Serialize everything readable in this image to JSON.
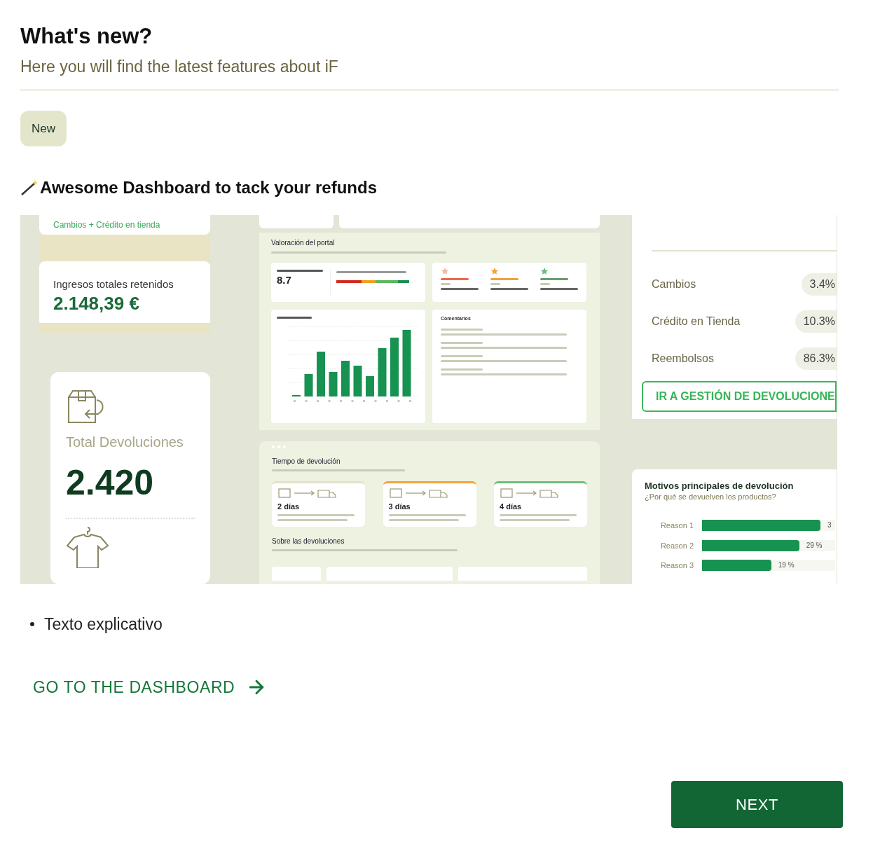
{
  "header": {
    "title": "What's new?",
    "subtitle": "Here you will find the latest features about iF"
  },
  "badge": "New",
  "feature_title": "Awesome Dashboard to tack your refunds",
  "preview": {
    "left": {
      "caption": "Cambios + Crédito en tienda",
      "revenue_label": "Ingresos totales retenidos",
      "revenue_value": "2.148,39 €",
      "returns_label": "Total Devoluciones",
      "returns_value": "2.420"
    },
    "portal": {
      "title": "Valoración del portal",
      "score": "8.7",
      "comments_title": "Comentarios",
      "star_groups": [
        {
          "color": "#f2b9a2"
        },
        {
          "color": "#f4a338"
        },
        {
          "color": "#6dbb7e"
        }
      ]
    },
    "times": {
      "title": "Tiempo de devolución",
      "cards": [
        {
          "value": "2 días",
          "color": "#e6e2c8"
        },
        {
          "value": "3 días",
          "color": "#f4a338"
        },
        {
          "value": "4 días",
          "color": "#6dbb7e"
        }
      ]
    },
    "about_title": "Sobre las devoluciones",
    "breakdown": {
      "rows": [
        {
          "label": "Cambios",
          "value": "3.4%"
        },
        {
          "label": "Crédito en Tienda",
          "value": "10.3%"
        },
        {
          "label": "Reembolsos",
          "value": "86.3%"
        }
      ],
      "button": "IR A GESTIÓN DE DEVOLUCIONE"
    },
    "reasons": {
      "title": "Motivos principales de devolución",
      "subtitle": "¿Por qué se devuelven los productos?",
      "items": [
        {
          "label": "Reason 1",
          "value": "3",
          "level": 0.89
        },
        {
          "label": "Reason 2",
          "value": "29 %",
          "level": 0.73
        },
        {
          "label": "Reason 3",
          "value": "19 %",
          "level": 0.52
        }
      ]
    }
  },
  "bullets": [
    "Texto explicativo"
  ],
  "link": "GO TO THE DASHBOARD",
  "next_button": "NEXT"
}
